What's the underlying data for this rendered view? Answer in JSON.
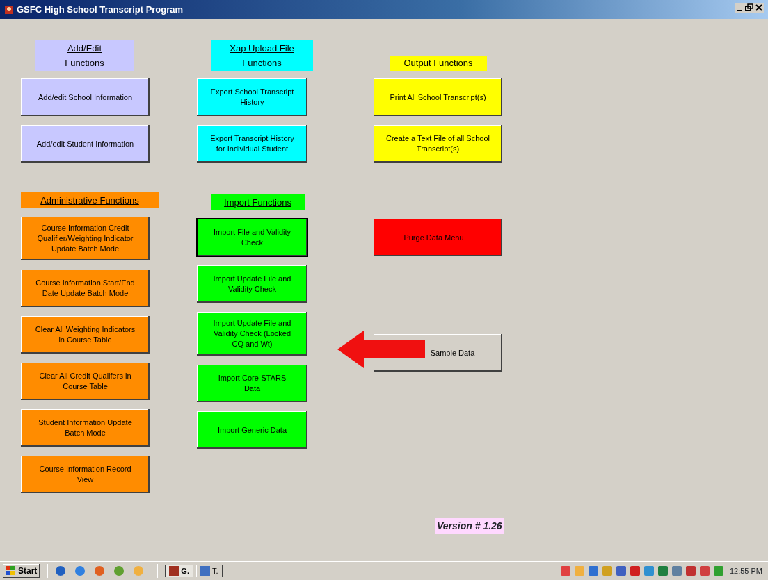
{
  "window": {
    "title": "GSFC High School Transcript Program"
  },
  "columns": [
    {
      "groups": [
        {
          "header": "Add/Edit Functions",
          "color": "#c8c8ff",
          "buttons": [
            {
              "label": "Add/edit School Information",
              "default": false
            },
            {
              "label": "Add/edit Student Information",
              "default": false
            }
          ]
        },
        {
          "header": "Administrative Functions",
          "color": "#ff8c00",
          "buttons": [
            {
              "label": "Course Information Credit Qualifier/Weighting Indicator Update Batch Mode",
              "default": false
            },
            {
              "label": "Course Information Start/End Date Update Batch Mode",
              "default": false
            },
            {
              "label": "Clear All Weighting Indicators in Course Table",
              "default": false
            },
            {
              "label": "Clear All Credit Qualifers in Course Table",
              "default": false
            },
            {
              "label": "Student Information Update Batch Mode",
              "default": false
            },
            {
              "label": "Course Information Record View",
              "default": false
            }
          ]
        }
      ]
    },
    {
      "groups": [
        {
          "header": "Xap Upload File Functions",
          "color": "#00ffff",
          "buttons": [
            {
              "label": "Export School Transcript History",
              "default": false
            },
            {
              "label": "Export Transcript History for Individual Student",
              "default": false
            }
          ]
        },
        {
          "header": "Import Functions",
          "color": "#00ff00",
          "buttons": [
            {
              "label": "Import File and Validity Check",
              "default": true
            },
            {
              "label": "Import Update File and Validity Check",
              "default": false
            },
            {
              "label": "Import Update File and Validity Check (Locked CQ and Wt)",
              "default": false
            },
            {
              "label": "Import Core-STARS Data",
              "default": false
            },
            {
              "label": "Import Generic Data",
              "default": false
            }
          ]
        }
      ]
    },
    {
      "groups": [
        {
          "header": "Output Functions",
          "color": "#ffff00",
          "buttons": [
            {
              "label": "Print All School Transcript(s)",
              "default": false
            },
            {
              "label": "Create a Text File of all School Transcript(s)",
              "default": false
            }
          ]
        },
        {
          "color": "#ff0000",
          "buttons": [
            {
              "label": "Purge Data Menu",
              "default": false
            }
          ]
        },
        {
          "color": "#d4d0c8",
          "buttons": [
            {
              "label": "Sample Data",
              "default": false
            }
          ]
        }
      ]
    }
  ],
  "version": "Version # 1.26",
  "taskbar": {
    "start": "Start",
    "tasks": [
      {
        "label": "G.",
        "selected": true
      },
      {
        "label": "T.",
        "selected": false
      }
    ],
    "clock": "12:55 PM"
  }
}
